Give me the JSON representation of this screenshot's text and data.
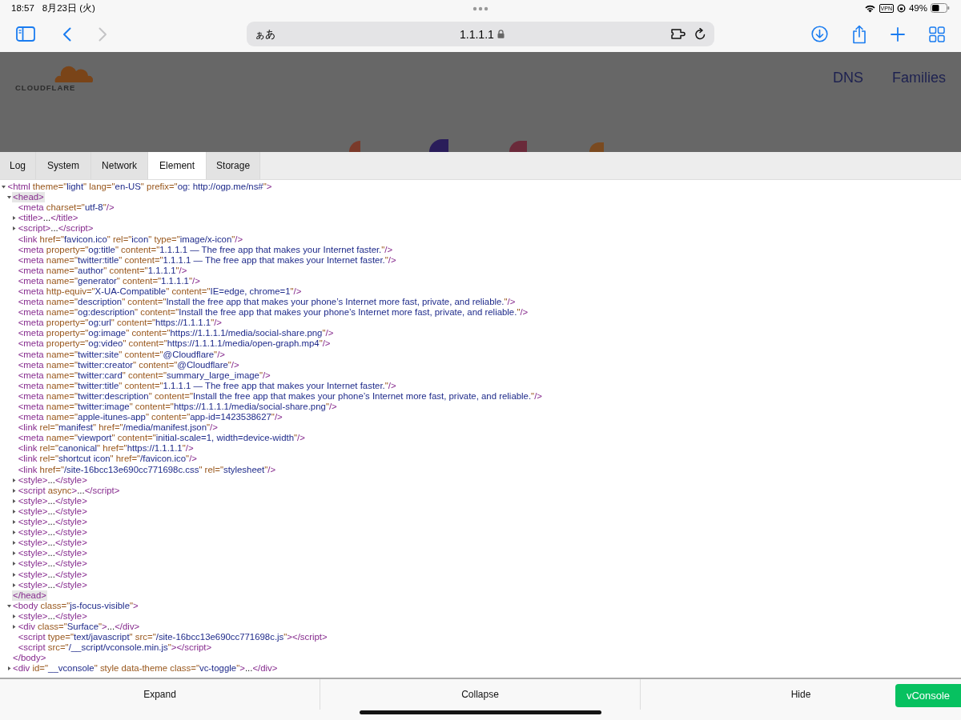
{
  "status_bar": {
    "time": "18:57",
    "date": "8月23日 (火)",
    "vpn": "VPN",
    "battery": "49%"
  },
  "toolbar": {
    "text_size": "ぁあ",
    "url": "1.1.1.1",
    "forward_disabled": true
  },
  "site": {
    "logo": "CLOUDFLARE",
    "nav": [
      "DNS",
      "Families"
    ]
  },
  "tabs": [
    {
      "label": "Log",
      "selected": false
    },
    {
      "label": "System",
      "selected": false
    },
    {
      "label": "Network",
      "selected": false
    },
    {
      "label": "Element",
      "selected": true
    },
    {
      "label": "Storage",
      "selected": false
    }
  ],
  "tree": [
    {
      "text": "<html theme=\"light\" lang=\"en-US\" prefix=\"og: http://ogp.me/ns#\">",
      "expanded": true,
      "selected": false,
      "children": [
        {
          "text": "<head>",
          "expanded": true,
          "selected": true,
          "close": "</head>",
          "children": [
            {
              "text": "<meta charset=\"utf-8\"/>",
              "selected": false
            },
            {
              "text": "<title>...</title>",
              "expanded": false,
              "selected": false
            },
            {
              "text": "<script>...</script>",
              "expanded": false,
              "selected": false
            },
            {
              "text": "<link href=\"favicon.ico\" rel=\"icon\" type=\"image/x-icon\"/>",
              "selected": false
            },
            {
              "text": "<meta property=\"og:title\" content=\"1.1.1.1 — The free app that makes your Internet faster.\"/>",
              "selected": false
            },
            {
              "text": "<meta name=\"twitter:title\" content=\"1.1.1.1 — The free app that makes your Internet faster.\"/>",
              "selected": false
            },
            {
              "text": "<meta name=\"author\" content=\"1.1.1.1\"/>",
              "selected": false
            },
            {
              "text": "<meta name=\"generator\" content=\"1.1.1.1\"/>",
              "selected": false
            },
            {
              "text": "<meta http-equiv=\"X-UA-Compatible\" content=\"IE=edge, chrome=1\"/>",
              "selected": false
            },
            {
              "text": "<meta name=\"description\" content=\"Install the free app that makes your phone’s Internet more fast, private, and reliable.\"/>",
              "selected": false
            },
            {
              "text": "<meta name=\"og:description\" content=\"Install the free app that makes your phone’s Internet more fast, private, and reliable.\"/>",
              "selected": false
            },
            {
              "text": "<meta property=\"og:url\" content=\"https://1.1.1.1\"/>",
              "selected": false
            },
            {
              "text": "<meta property=\"og:image\" content=\"https://1.1.1.1/media/social-share.png\"/>",
              "selected": false
            },
            {
              "text": "<meta property=\"og:video\" content=\"https://1.1.1.1/media/open-graph.mp4\"/>",
              "selected": false
            },
            {
              "text": "<meta name=\"twitter:site\" content=\"@Cloudflare\"/>",
              "selected": false
            },
            {
              "text": "<meta name=\"twitter:creator\" content=\"@Cloudflare\"/>",
              "selected": false
            },
            {
              "text": "<meta name=\"twitter:card\" content=\"summary_large_image\"/>",
              "selected": false
            },
            {
              "text": "<meta name=\"twitter:title\" content=\"1.1.1.1 — The free app that makes your Internet faster.\"/>",
              "selected": false
            },
            {
              "text": "<meta name=\"twitter:description\" content=\"Install the free app that makes your phone’s Internet more fast, private, and reliable.\"/>",
              "selected": false
            },
            {
              "text": "<meta name=\"twitter:image\" content=\"https://1.1.1.1/media/social-share.png\"/>",
              "selected": false
            },
            {
              "text": "<meta name=\"apple-itunes-app\" content=\"app-id=1423538627\"/>",
              "selected": false
            },
            {
              "text": "<link rel=\"manifest\" href=\"/media/manifest.json\"/>",
              "selected": false
            },
            {
              "text": "<meta name=\"viewport\" content=\"initial-scale=1, width=device-width\"/>",
              "selected": false
            },
            {
              "text": "<link rel=\"canonical\" href=\"https://1.1.1.1\"/>",
              "selected": false
            },
            {
              "text": "<link rel=\"shortcut icon\" href=\"/favicon.ico\"/>",
              "selected": false
            },
            {
              "text": "<link href=\"/site-16bcc13e690cc771698c.css\" rel=\"stylesheet\"/>",
              "selected": false
            },
            {
              "text": "<style>...</style>",
              "expanded": false,
              "selected": false
            },
            {
              "text": "<script async>...</script>",
              "expanded": false,
              "selected": false
            },
            {
              "text": "<style>...</style>",
              "expanded": false,
              "selected": false
            },
            {
              "text": "<style>...</style>",
              "expanded": false,
              "selected": false
            },
            {
              "text": "<style>...</style>",
              "expanded": false,
              "selected": false
            },
            {
              "text": "<style>...</style>",
              "expanded": false,
              "selected": false
            },
            {
              "text": "<style>...</style>",
              "expanded": false,
              "selected": false
            },
            {
              "text": "<style>...</style>",
              "expanded": false,
              "selected": false
            },
            {
              "text": "<style>...</style>",
              "expanded": false,
              "selected": false
            },
            {
              "text": "<style>...</style>",
              "expanded": false,
              "selected": false
            },
            {
              "text": "<style>...</style>",
              "expanded": false,
              "selected": false
            }
          ]
        },
        {
          "text": "<body class=\"js-focus-visible\">",
          "expanded": true,
          "selected": false,
          "close": "</body>",
          "children": [
            {
              "text": "<style>...</style>",
              "expanded": false,
              "selected": false
            },
            {
              "text": "<div class=\"Surface\">...</div>",
              "expanded": false,
              "selected": false
            },
            {
              "text": "<script type=\"text/javascript\" src=\"/site-16bcc13e690cc771698c.js\"></script>",
              "selected": false
            },
            {
              "text": "<script src=\"/__script/vconsole.min.js\"></script>",
              "selected": false
            }
          ]
        },
        {
          "text": "<div id=\"__vconsole\" style data-theme class=\"vc-toggle\">...</div>",
          "expanded": false,
          "selected": false
        }
      ]
    }
  ],
  "actions": [
    "Expand",
    "Collapse",
    "Hide"
  ],
  "vconsole_button": "vConsole"
}
